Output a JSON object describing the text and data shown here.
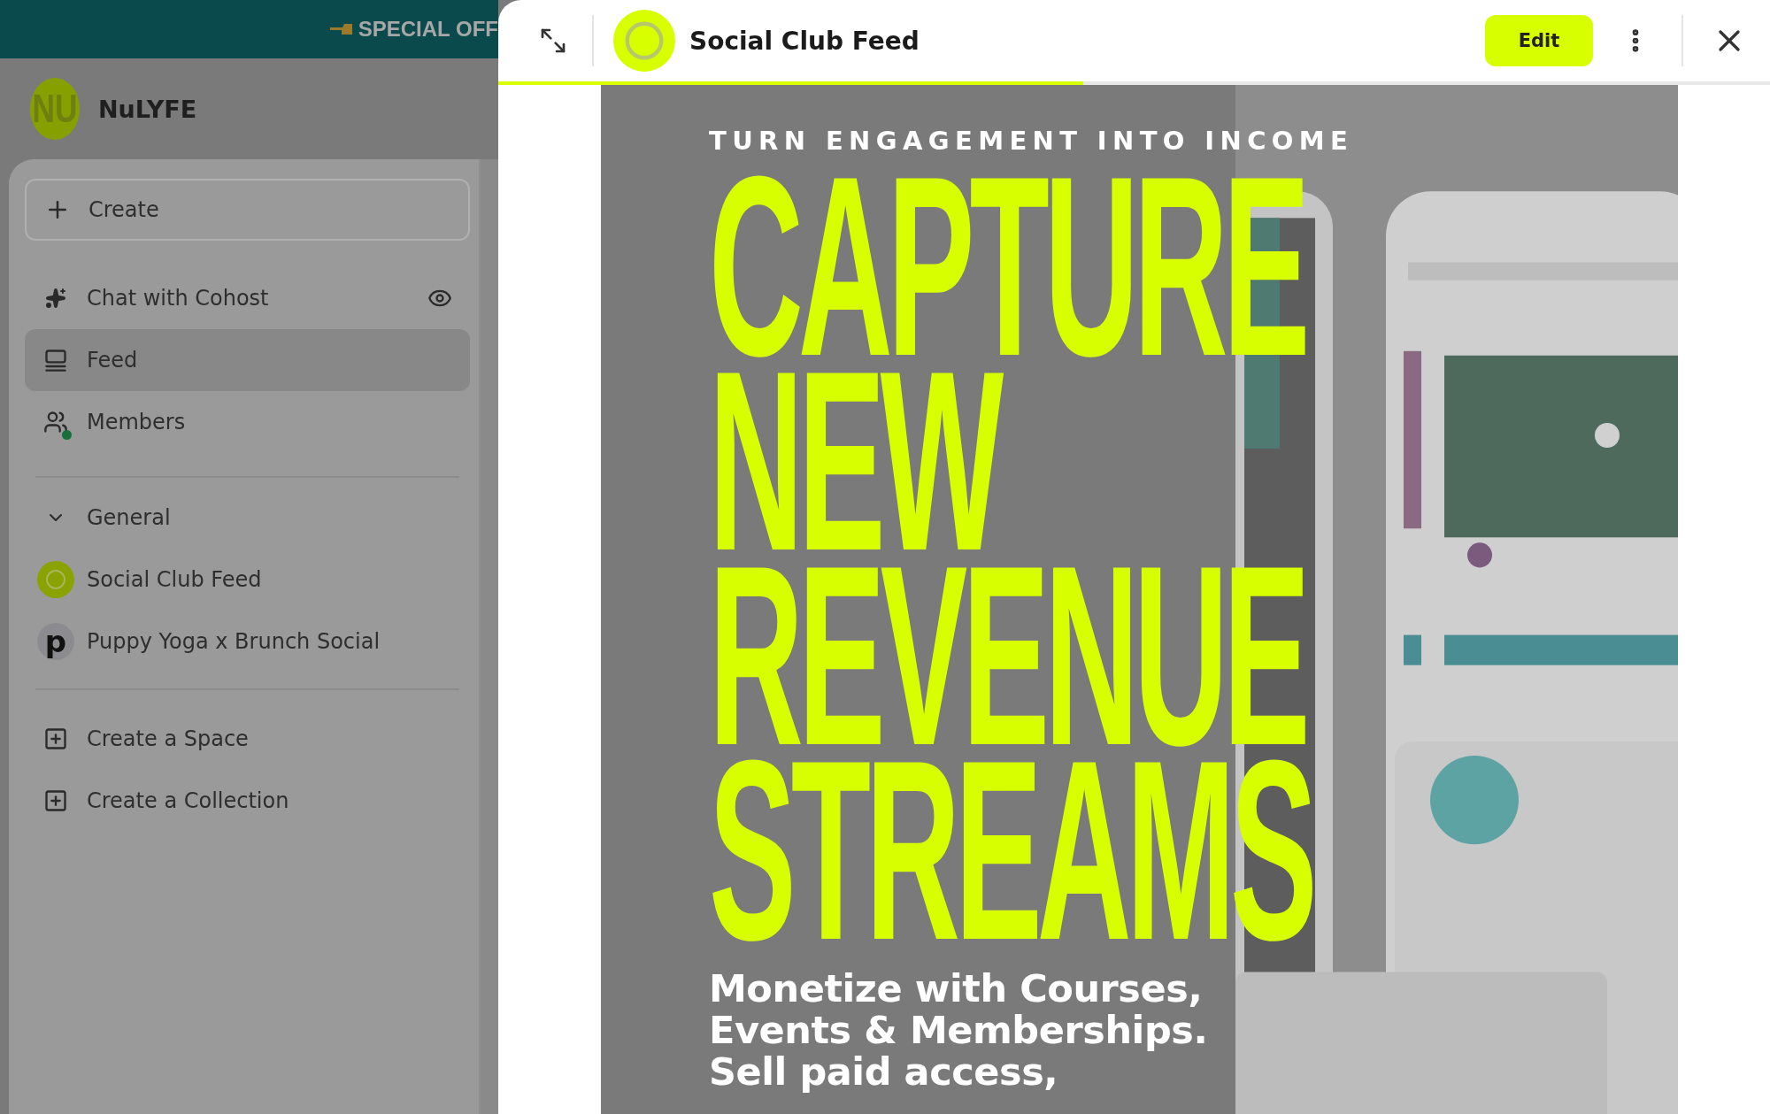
{
  "banner": {
    "text": "SPECIAL OFF"
  },
  "sidebar": {
    "brand": {
      "logo_text": "NU",
      "name": "NuLYFE"
    },
    "create_button": "Create",
    "nav": [
      {
        "kind": "chat",
        "label": "Chat with Cohost",
        "selected": false,
        "dot": false,
        "eye": true
      },
      {
        "kind": "feed",
        "label": "Feed",
        "selected": true,
        "dot": false,
        "eye": false
      },
      {
        "kind": "members",
        "label": "Members",
        "selected": false,
        "dot": true,
        "eye": false
      }
    ],
    "section": {
      "label": "General",
      "expanded": true,
      "spaces": [
        {
          "kind": "logo",
          "label": "Social Club Feed"
        },
        {
          "kind": "letter",
          "letter": "p",
          "label": "Puppy Yoga x Brunch Social"
        }
      ]
    },
    "actions": [
      "Create a Space",
      "Create a Collection"
    ]
  },
  "panel": {
    "title": "Social Club Feed",
    "edit_button": "Edit",
    "progress": {
      "level": 0.46
    },
    "post": {
      "kicker": "TURN ENGAGEMENT INTO INCOME",
      "headline": [
        "CAPTURE",
        "NEW",
        "REVENUE",
        "STREAMS"
      ],
      "body_lines": [
        "Monetize with Courses,",
        "Events & Memberships.",
        "Sell paid access,"
      ],
      "media": {
        "kind": "picture"
      }
    }
  }
}
